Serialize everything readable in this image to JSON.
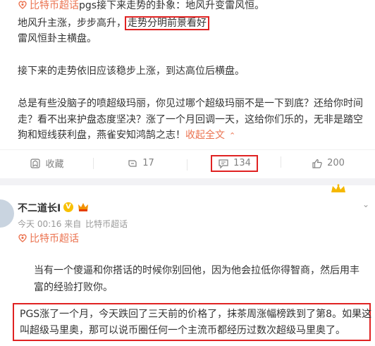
{
  "post1": {
    "topic_link": "比特币超话",
    "topic_rest": "pgs接下来走势的卦象：地风升变雷风恒。",
    "line2_a": "地风升主涨，步步高升，",
    "line2_boxed": "走势分明前景看好",
    "line3": "雷风恒卦主横盘。",
    "line4": "接下来的走势依旧应该稳步上涨，到达高位后横盘。",
    "line5": "总是有些没脑子的喷超级玛丽，你见过哪个超级玛丽不是一下到底？还给你时间",
    "line6": "走？看不出来护盘态度坚决？涨了一个月回调一天，这给你们乐的，无非是踏空",
    "line7_a": "狗和短线获利盘，燕雀安知鸿鹄之志！",
    "fold_text": "收起全文",
    "actions": {
      "favorite": "收藏",
      "repost": "17",
      "comment": "134",
      "like": "200"
    }
  },
  "post2": {
    "username": "不二道长I",
    "vip_mark": "V",
    "meta_time": "今天 00:16",
    "meta_from": "来自",
    "meta_source": "比特币超话",
    "topic_link": "比特币超话",
    "body_line1": "当有一个傻逼和你搭话的时候你别回他，因为他会拉低你得智商，然后用丰",
    "body_line2": "富的经验打败你。",
    "boxed_line1": "PGS涨了一个月，今天跌回了三天前的价格了，抹茶周涨幅榜跌到了第8。如果这",
    "boxed_line2": "叫超级马里奥，那可以说币圈任何一个主流币都经历过数次超级马里奥了。"
  },
  "icons": {
    "topic": "super-topic-icon",
    "favorite": "favorite-icon",
    "repost": "repost-icon",
    "comment": "comment-icon",
    "like": "like-icon",
    "crown": "crown-icon",
    "dropdown": "chevron-down-icon"
  },
  "colors": {
    "link": "#eb7350",
    "highlight_box": "#e02222",
    "muted": "#808080"
  }
}
